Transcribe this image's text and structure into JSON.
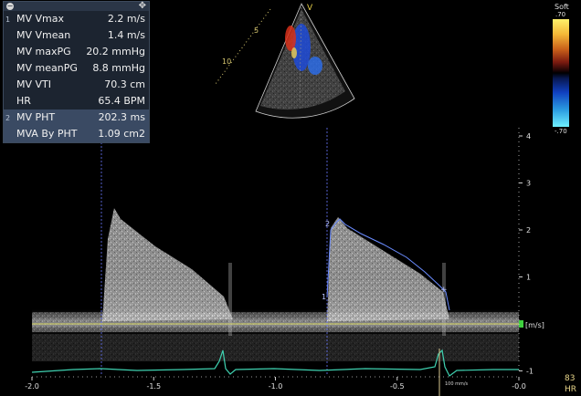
{
  "measurements": {
    "groups": [
      {
        "index": "1",
        "rows": [
          {
            "label": "MV Vmax",
            "value": "2.2 m/s"
          },
          {
            "label": "MV Vmean",
            "value": "1.4 m/s"
          },
          {
            "label": "MV maxPG",
            "value": "20.2 mmHg"
          },
          {
            "label": "MV meanPG",
            "value": "8.8 mmHg"
          },
          {
            "label": "MV VTI",
            "value": "70.3 cm"
          },
          {
            "label": "HR",
            "value": "65.4 BPM"
          }
        ]
      },
      {
        "index": "2",
        "rows": [
          {
            "label": "MV PHT",
            "value": "202.3 ms"
          },
          {
            "label": "MVA By PHT",
            "value": "1.09 cm2"
          }
        ]
      }
    ]
  },
  "color_scale": {
    "title": "Soft",
    "top_value": ".70",
    "bottom_value": "-.70"
  },
  "sector": {
    "depth_labels": [
      "5",
      "10"
    ],
    "probe_marker": "V"
  },
  "doppler": {
    "velocity_unit": "[m/s]",
    "velocity_ticks": [
      "4",
      "3",
      "2",
      "1",
      "-1"
    ],
    "time_ticks": [
      "-2.0",
      "-1.5",
      "-1.0",
      "-0.5",
      "-0.0"
    ],
    "markers": [
      "1",
      "2"
    ],
    "sweep_label": "100 mm/s",
    "colors": {
      "baseline": "#c8c86a",
      "trace": "#6a8cff",
      "ecg": "#3fd1b0",
      "caliper": "#6a78ff"
    }
  },
  "hr_display": {
    "value": "83",
    "label": "HR"
  }
}
